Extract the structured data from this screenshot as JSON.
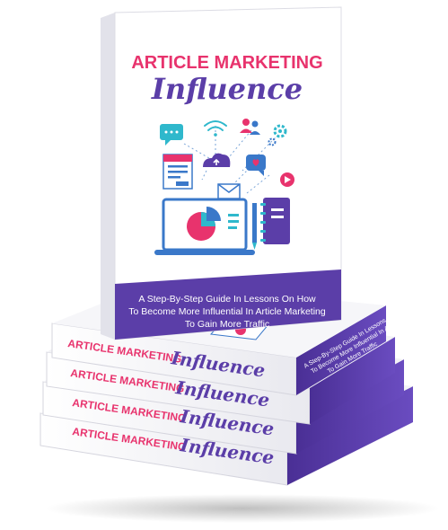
{
  "cover": {
    "title_line1": "ARTICLE MARKETING",
    "title_line2": "Influence",
    "subtitle_line1": "A Step-By-Step Guide In Lessons On How",
    "subtitle_line2": "To Become More Influential In Article Marketing",
    "subtitle_line3": "To Gain More Traffic"
  },
  "spine": {
    "title_line1": "ARTICLE MARKETING",
    "title_line2": "Influence"
  },
  "spine_side_text": {
    "line1": "A Step-By-Step Guide In Lessons On How",
    "line2": "To Become More Influential In Article Marketing",
    "line3": "To Gain More Traffic"
  },
  "colors": {
    "brand_pink": "#e8336d",
    "brand_purple": "#5b3ea8",
    "accent_teal": "#2fb8cc",
    "icon_blue": "#3a78c9"
  },
  "icons": [
    "chat-bubble-icon",
    "wifi-icon",
    "users-icon",
    "gear-icon",
    "document-icon",
    "cloud-upload-icon",
    "heart-chat-icon",
    "play-icon",
    "mail-icon",
    "laptop-pie-chart-icon",
    "pencil-icon",
    "notebook-icon"
  ]
}
